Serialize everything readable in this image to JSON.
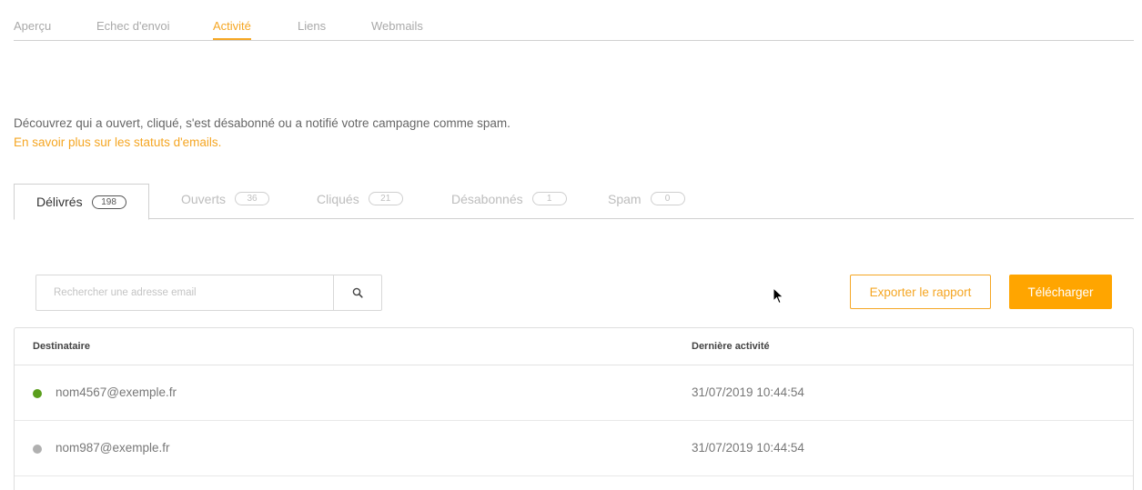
{
  "top_nav": {
    "tabs": [
      {
        "label": "Aperçu"
      },
      {
        "label": "Echec d'envoi"
      },
      {
        "label": "Activité"
      },
      {
        "label": "Liens"
      },
      {
        "label": "Webmails"
      }
    ],
    "active_tab": "Activité"
  },
  "intro": {
    "text": "Découvrez qui a ouvert, cliqué, s'est désabonné ou a notifié votre campagne comme spam.",
    "link": "En savoir plus sur les statuts d'emails."
  },
  "status_tabs": [
    {
      "label": "Délivrés",
      "count": "198"
    },
    {
      "label": "Ouverts",
      "count": "36"
    },
    {
      "label": "Cliqués",
      "count": "21"
    },
    {
      "label": "Désabonnés",
      "count": "1"
    },
    {
      "label": "Spam",
      "count": "0"
    }
  ],
  "active_status_tab": "Délivrés",
  "search": {
    "placeholder": "Rechercher une adresse email",
    "value": "",
    "icon": "search-icon"
  },
  "buttons": {
    "export": "Exporter le rapport",
    "download": "Télécharger"
  },
  "table": {
    "columns": [
      "Destinataire",
      "Dernière activité"
    ],
    "rows": [
      {
        "status_color": "#5a9e1c",
        "email": "nom4567@exemple.fr",
        "last_activity": "31/07/2019 10:44:54"
      },
      {
        "status_color": "#b0b0b0",
        "email": "nom987@exemple.fr",
        "last_activity": "31/07/2019 10:44:54"
      }
    ]
  },
  "colors": {
    "accent": "#f5a623",
    "button_fill": "#ffa500"
  }
}
